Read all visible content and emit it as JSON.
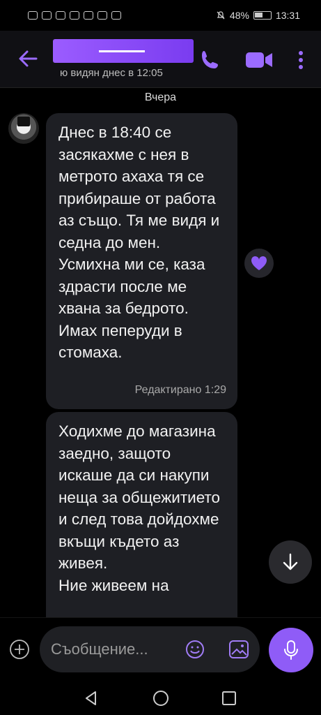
{
  "status_bar": {
    "battery": "48%",
    "time": "13:31"
  },
  "header": {
    "last_seen": "ю видян днес в 12:05"
  },
  "chat": {
    "date_separator": "Вчера",
    "messages": [
      {
        "text": "Днес в 18:40 се засякахме с нея в метрото ахаха тя се прибираше от работа аз също. Тя ме видя и седна до мен. Усмихна ми се, каза здрасти после ме хвана за бедрото.\nИмах пеперуди в стомаха.",
        "edited_label": "Редактирано",
        "time": "1:29",
        "reaction": "heart"
      },
      {
        "text": "Ходихме до магазина заедно, защото искаше да си накупи неща за общежитието и след това дойдохме вкъщи където аз живея.\nНие живеем на"
      }
    ]
  },
  "composer": {
    "placeholder": "Съобщение..."
  },
  "colors": {
    "accent": "#8f5cf7",
    "bubble": "#1e1f24",
    "background": "#000000"
  },
  "icons": [
    "back-arrow-icon",
    "phone-icon",
    "video-icon",
    "more-vert-icon",
    "heart-icon",
    "arrow-down-icon",
    "plus-icon",
    "emoji-icon",
    "sticker-icon",
    "mic-icon",
    "nav-back-icon",
    "nav-home-icon",
    "nav-recents-icon"
  ]
}
